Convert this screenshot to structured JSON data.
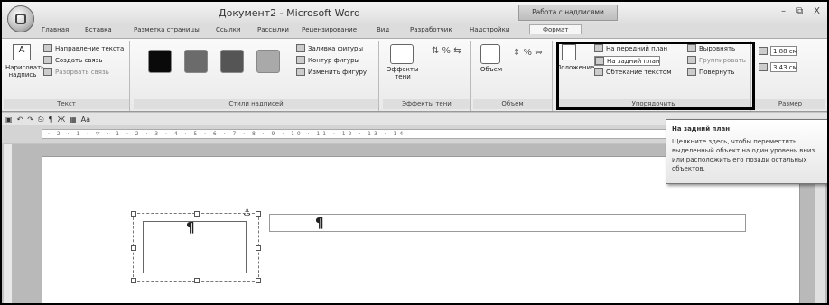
{
  "window": {
    "title": "Документ2 - Microsoft Word",
    "context_tab": "Работа с надписями",
    "controls": [
      "–",
      "⧉",
      "X"
    ]
  },
  "tabs": [
    "Главная",
    "Вставка",
    "Разметка страницы",
    "Ссылки",
    "Рассылки",
    "Рецензирование",
    "Вид",
    "Разработчик",
    "Надстройки",
    "Формат"
  ],
  "ribbon": {
    "text_group": {
      "label": "Текст",
      "draw_label": "Нарисовать надпись",
      "items": [
        "Направление текста",
        "Создать связь",
        "Разорвать связь"
      ]
    },
    "styles_group": {
      "label": "Стили надписей",
      "items": [
        "Заливка фигуры",
        "Контур фигуры",
        "Изменить фигуру"
      ]
    },
    "shadow_group": {
      "label": "Эффекты тени",
      "btn": "Эффекты тени"
    },
    "volume_group": {
      "label": "Объем",
      "btn": "Объем"
    },
    "arrange_group": {
      "label": "Упорядочить",
      "position": "Положение",
      "items": [
        "На передний план",
        "На задний план",
        "Обтекание текстом",
        "Выровнять",
        "Группировать",
        "Повернуть"
      ]
    },
    "size_group": {
      "label": "Размер",
      "height": "1,88 см",
      "width": "3,43 см"
    }
  },
  "doc": {
    "pilcrow": "¶"
  },
  "tooltip": {
    "title": "На задний план",
    "body": "Щелкните здесь, чтобы переместить выделенный объект на один уровень вниз или расположить его позади остальных объектов."
  },
  "swatch_colors": [
    "#0a0a0a",
    "#6b6b6b",
    "#555555",
    "#a9a9a9"
  ]
}
